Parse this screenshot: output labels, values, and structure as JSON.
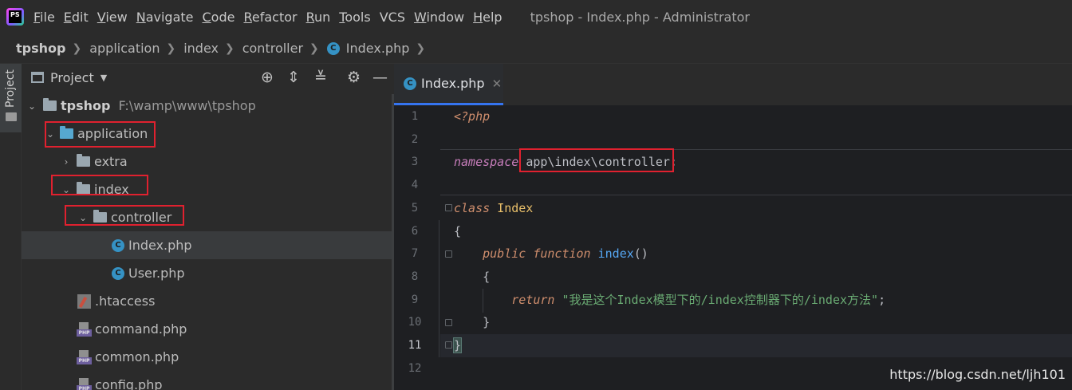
{
  "menubar": {
    "logo_text": "PS",
    "items": [
      {
        "u": "F",
        "rest": "ile"
      },
      {
        "u": "E",
        "rest": "dit"
      },
      {
        "u": "V",
        "rest": "iew"
      },
      {
        "u": "N",
        "rest": "avigate"
      },
      {
        "u": "C",
        "rest": "ode"
      },
      {
        "u": "R",
        "rest": "efactor"
      },
      {
        "u": "R",
        "rest": "un"
      },
      {
        "u": "T",
        "rest": "ools"
      },
      {
        "u": "",
        "rest": "VCS"
      },
      {
        "u": "W",
        "rest": "indow"
      },
      {
        "u": "H",
        "rest": "elp"
      }
    ],
    "window_title": "tpshop - Index.php - Administrator"
  },
  "breadcrumb": {
    "items": [
      "tpshop",
      "application",
      "index",
      "controller",
      "Index.php"
    ],
    "separator": "❯",
    "file_icon_letter": "C"
  },
  "tool_strip": {
    "label": "Project"
  },
  "project_panel": {
    "title": "Project",
    "tree": [
      {
        "label": "tpshop",
        "path": "F:\\wamp\\www\\tpshop"
      },
      {
        "label": "application"
      },
      {
        "label": "extra"
      },
      {
        "label": "index"
      },
      {
        "label": "controller"
      },
      {
        "label": "Index.php"
      },
      {
        "label": "User.php"
      },
      {
        "label": ".htaccess"
      },
      {
        "label": "command.php"
      },
      {
        "label": "common.php"
      },
      {
        "label": "config.php"
      }
    ],
    "php_badge": "PHP",
    "class_badge": "C"
  },
  "editor": {
    "tab": {
      "label": "Index.php",
      "close": "✕"
    },
    "line_numbers": [
      "1",
      "2",
      "3",
      "4",
      "5",
      "6",
      "7",
      "8",
      "9",
      "10",
      "11",
      "12"
    ],
    "current_line": 11,
    "code": {
      "l1": "<?php",
      "l3_kw": "namespace",
      "l3_ns": "app\\index\\controller",
      "l3_end": ";",
      "l5_kw": "class",
      "l5_name": "Index",
      "l6": "{",
      "l7_kw1": "public",
      "l7_kw2": "function",
      "l7_name": "index",
      "l7_parens": "()",
      "l8": "{",
      "l9_kw": "return",
      "l9_str": "\"我是这个Index模型下的/index控制器下的/index方法\"",
      "l9_end": ";",
      "l10": "}",
      "l11": "}"
    }
  },
  "watermark": "https://blog.csdn.net/ljh101",
  "colors": {
    "highlight_box": "#e0212f",
    "accent": "#3574f0",
    "php_class_icon": "#3592c4"
  }
}
